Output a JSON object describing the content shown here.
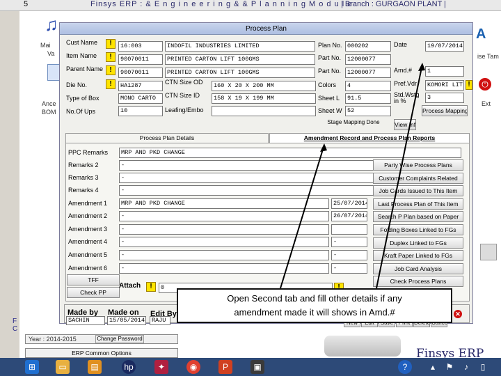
{
  "app": {
    "title": "Finsys ERP : & E n g i n e e r i n g  & &  P l a n n i n g  M o d u l e",
    "branch": "| Branch : GURGAON PLANT |"
  },
  "desktop": {
    "left_labels": [
      "Mai",
      "Va",
      "Ance",
      "BOM"
    ],
    "right_labels": [
      "ise Tam",
      "Ext"
    ],
    "bottom": {
      "year": "Year : 2014-2015",
      "change_password": "Change Password",
      "common_options": "ERP Common Options",
      "brand": "Finsys ERP"
    }
  },
  "dialog": {
    "title": "Process Plan",
    "header": {
      "cust_name": {
        "label": "Cust Name",
        "code": "16:003",
        "value": "INDOFIL INDUSTRIES LIMITED"
      },
      "item_name": {
        "label": "Item Name",
        "code": "90070011",
        "value": "PRINTED CARTON LIFT 100GMS"
      },
      "parent_name": {
        "label": "Parent Name",
        "code": "90070011",
        "value": "PRINTED CARTON LIFT 100GMS"
      },
      "die_no": {
        "label": "Die No.",
        "value": "HA1287"
      },
      "type_of_box": {
        "label": "Type of Box",
        "value": "MONO CARTO"
      },
      "no_of_ups": {
        "label": "No.Of Ups",
        "value": "10"
      },
      "ctn_size_od": {
        "label": "CTN Size OD",
        "value": "160 X 20 X 200 MM"
      },
      "ctn_size_id": {
        "label": "CTN Size ID",
        "value": "158 X 19 X 199 MM"
      },
      "leafing_embo": {
        "label": "Leafing/Embo",
        "value": ""
      },
      "plan_no": {
        "label": "Plan No.",
        "value": "000202"
      },
      "part_no1": {
        "label": "Part No.",
        "value": "12000077"
      },
      "part_no2": {
        "label": "Part No.",
        "value": "12000077"
      },
      "colors": {
        "label": "Colors",
        "value": "4"
      },
      "sheet_l": {
        "label": "Sheet L",
        "value": "91.5"
      },
      "sheet_w": {
        "label": "Sheet W",
        "value": "52"
      },
      "date": {
        "label": "Date",
        "value": "19/07/2014"
      },
      "amd_no": {
        "label": "Amd.#",
        "value": "1"
      },
      "pref_vdr": {
        "label": "Pref.Vdr",
        "value": "KOMORI LIT"
      },
      "std_wastg": {
        "label": "Std.Wstg\nin %",
        "value": "3"
      },
      "stage_mapping_done": "Stage Mapping Done",
      "view_info": "View Info",
      "process_mapping": "Process Mapping"
    },
    "tabs": [
      "Process Plan Details",
      "Amendment Record and Process Plan Reports"
    ],
    "remarks": [
      {
        "label": "PPC Remarks",
        "value": "MRP AND PKD CHANGE"
      },
      {
        "label": "Remarks 2",
        "value": "-"
      },
      {
        "label": "Remarks 3",
        "value": "-"
      },
      {
        "label": "Remarks 4",
        "value": "-"
      },
      {
        "label": "Amendment 1",
        "value": "MRP AND PKD CHANGE",
        "date": "25/07/2014"
      },
      {
        "label": "Amendment 2",
        "value": "-",
        "date": "26/07/2014"
      },
      {
        "label": "Amendment 3",
        "value": "-",
        "date": ""
      },
      {
        "label": "Amendment 4",
        "value": "-",
        "date": "-"
      },
      {
        "label": "Amendment 5",
        "value": "-",
        "date": "-"
      },
      {
        "label": "Amendment 6",
        "value": "-",
        "date": "-"
      }
    ],
    "report_buttons": [
      "Party Wise Process Plans",
      "Customer Complaints Related",
      "Job Cards Issued to This Item",
      "Last Process Plan of This Item",
      "Search P Plan based on Paper",
      "Folding Boxes Linked to FGs",
      "Duplex Linked to FGs",
      "Kraft Paper Linked to FGs",
      "Job Card Analysis",
      "Check Process Plans"
    ],
    "tff": "TFF",
    "check_pp": "Check PP",
    "attach": {
      "label": "Attach",
      "value": "0"
    },
    "footer": {
      "made_by": {
        "label": "Made by",
        "value": "SACHIN"
      },
      "made_on": {
        "label": "Made on",
        "value": "15/05/2014"
      },
      "edit_by": {
        "label": "Edit By",
        "value": "RAJU"
      },
      "buttons": [
        "New",
        "Edit",
        "Save",
        "Print",
        "Delete",
        "Cancel"
      ]
    }
  },
  "callout": {
    "line1": "Open Second tab and fill other details if any",
    "line2": "amendment made it will shows in Amd.#"
  },
  "colors": {
    "warning": "#ffe400",
    "close": "#d01010",
    "taskbar": "#2d4a78"
  }
}
